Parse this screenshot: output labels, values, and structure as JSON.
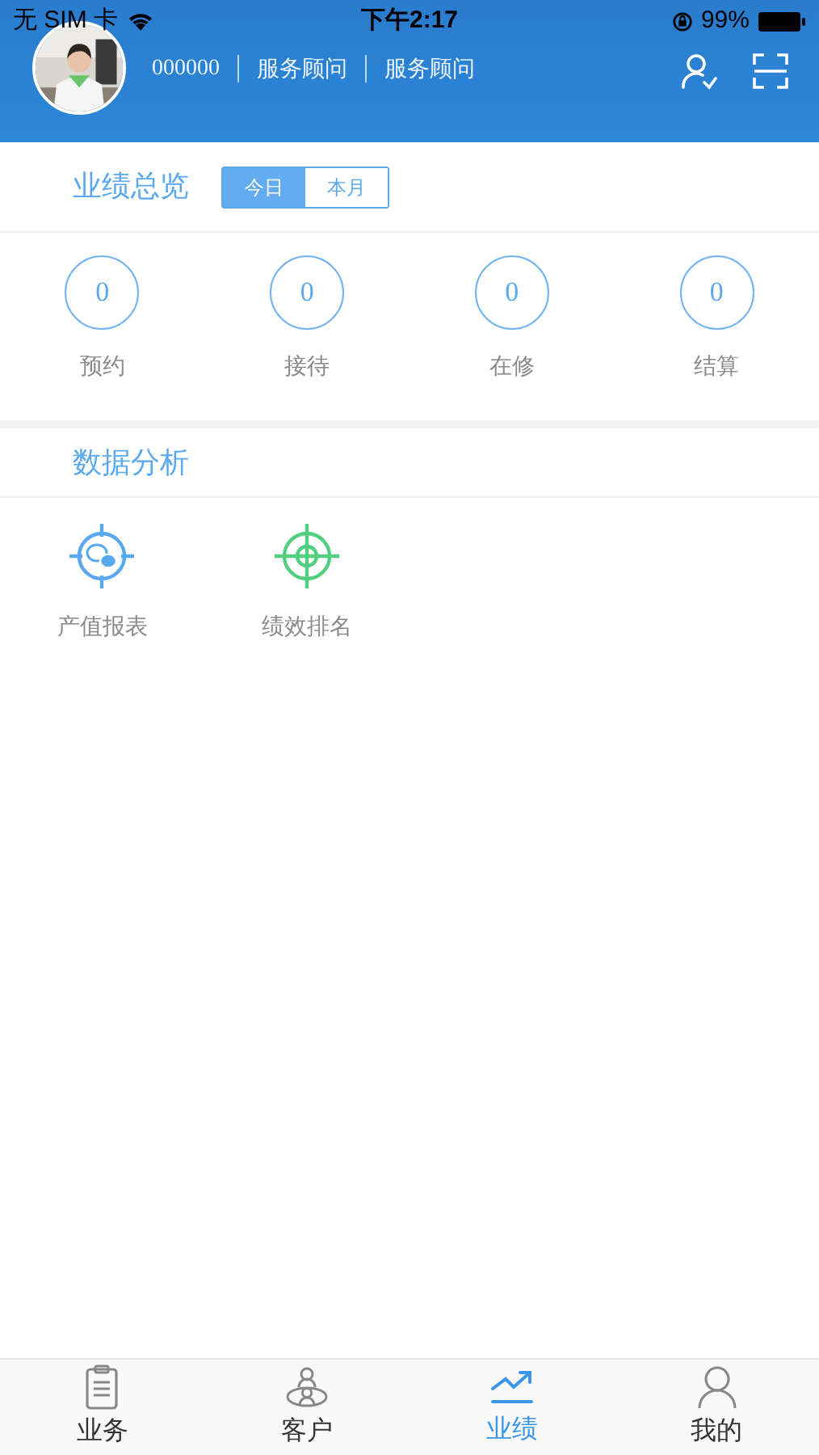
{
  "status_bar": {
    "carrier": "无 SIM 卡",
    "time": "下午2:17",
    "battery": "99%"
  },
  "profile": {
    "code": "000000",
    "roles": [
      "服务顾问",
      "服务顾问"
    ]
  },
  "overview": {
    "title": "业绩总览",
    "tabs": [
      {
        "label": "今日",
        "selected": true
      },
      {
        "label": "本月",
        "selected": false
      }
    ],
    "stats": [
      {
        "value": "0",
        "label": "预约"
      },
      {
        "value": "0",
        "label": "接待"
      },
      {
        "value": "0",
        "label": "在修"
      },
      {
        "value": "0",
        "label": "结算"
      }
    ]
  },
  "analysis": {
    "title": "数据分析",
    "items": [
      {
        "kind": "report",
        "label": "产值报表"
      },
      {
        "kind": "ranking",
        "label": "绩效排名"
      }
    ]
  },
  "tab_bar": [
    {
      "kind": "clipboard",
      "label": "业务",
      "selected": false
    },
    {
      "kind": "customers",
      "label": "客户",
      "selected": false
    },
    {
      "kind": "trend",
      "label": "业绩",
      "selected": true
    },
    {
      "kind": "person",
      "label": "我的",
      "selected": false
    }
  ]
}
